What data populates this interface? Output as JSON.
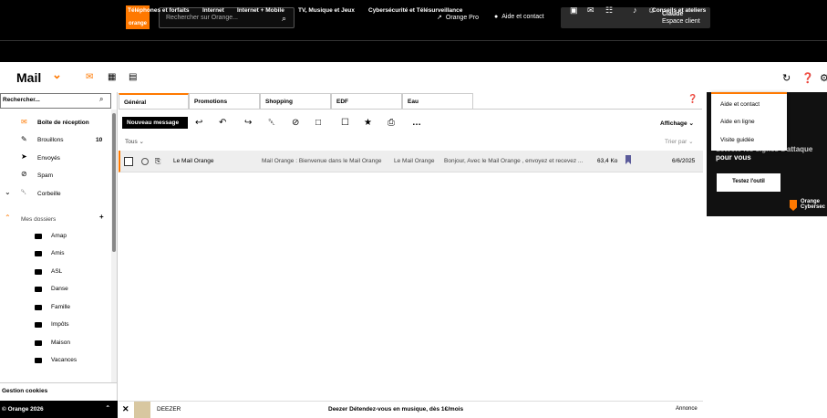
{
  "header": {
    "logo_text": "orange",
    "search_placeholder": "Rechercher sur Orange...",
    "orange_pro": "Orange Pro",
    "help_contact": "Aide et contact",
    "user_name": "Claude",
    "user_space": "Espace client"
  },
  "nav": {
    "items": [
      "Téléphones et forfaits",
      "Internet",
      "Internet + Mobile",
      "TV, Musique et Jeux",
      "Cybersécurité et Télésurveillance",
      "Conseils et ateliers"
    ]
  },
  "app": {
    "title": "Mail"
  },
  "sidebar": {
    "search_placeholder": "Rechercher...",
    "folders": [
      {
        "label": "Boîte de réception",
        "count": ""
      },
      {
        "label": "Brouillons",
        "count": "10"
      },
      {
        "label": "Envoyés",
        "count": ""
      },
      {
        "label": "Spam",
        "count": ""
      },
      {
        "label": "Corbeille",
        "count": ""
      }
    ],
    "my_folders_label": "Mes dossiers",
    "subfolders": [
      "Amap",
      "Amis",
      "ASL",
      "Danse",
      "Famille",
      "Impôts",
      "Maison",
      "Vacances"
    ],
    "cookies": "Gestion cookies",
    "copyright": "© Orange 2026"
  },
  "tabs": [
    "Général",
    "Promotions",
    "Shopping",
    "EDF",
    "Eau"
  ],
  "toolbar": {
    "new_message": "Nouveau message",
    "affichage": "Affichage"
  },
  "list": {
    "filter": "Tous",
    "sort": "Trier par",
    "rows": [
      {
        "sender": "Le Mail Orange",
        "subject": "Mail Orange : Bienvenue dans le Mail Orange",
        "from2": "Le Mail Orange",
        "preview": "Bonjour, Avec le Mail Orange , envoyez et recevez ...",
        "size": "63,4 Ko",
        "date": "6/6/2025"
      }
    ]
  },
  "help_menu": {
    "items": [
      "Aide et contact",
      "Aide en ligne",
      "Visite guidée"
    ]
  },
  "ad": {
    "line1": "détecte les signes d'attaque",
    "line2": "pour vous",
    "button": "Testez l'outil",
    "brand1": "Orange",
    "brand2": "Cybersec"
  },
  "bottom_ad": {
    "brand": "DEEZER",
    "text": "Deezer Détendez-vous en musique, dès 1€/mois",
    "label": "Annonce"
  },
  "colors": {
    "accent": "#ff7900",
    "bookmark": "#5b5b9a"
  }
}
